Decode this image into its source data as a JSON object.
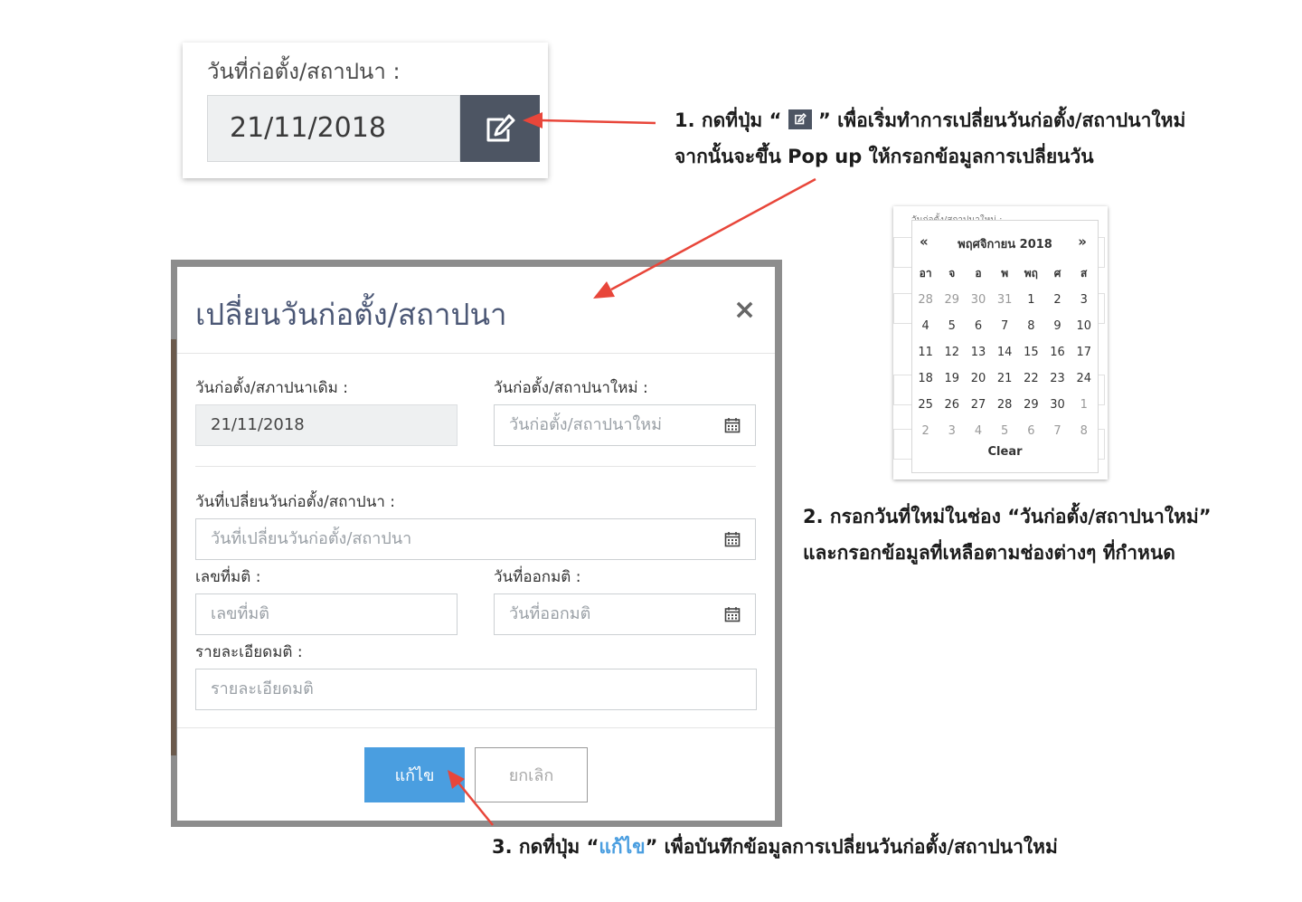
{
  "snippet": {
    "label": "วันที่ก่อตั้ง/สถาปนา :",
    "date_value": "21/11/2018"
  },
  "annotations": {
    "step1_line1_pre": "1. กดที่ปุ่ม “ ",
    "step1_line1_post": " ” เพื่อเริ่มทำการเปลี่ยนวันก่อตั้ง/สถาปนาใหม่",
    "step1_line2": "จากนั้นจะขึ้น Pop up ให้กรอกข้อมูลการเปลี่ยนวัน",
    "step2_line1": "2. กรอกวันที่ใหม่ในช่อง “วันก่อตั้ง/สถาปนาใหม่”",
    "step2_line2": "และกรอกข้อมูลที่เหลือตามช่องต่างๆ ที่กำหนด",
    "step3_pre": "3. กดที่ปุ่ม “",
    "step3_highlight": "แก้ไข",
    "step3_post": "” เพื่อบันทึกข้อมูลการเปลี่ยนวันก่อตั้ง/สถาปนาใหม่"
  },
  "modal": {
    "title": "เปลี่ยนวันก่อตั้ง/สถาปนา",
    "close": "×",
    "old_date_label": "วันก่อตั้ง/สภาปนาเดิม :",
    "old_date_value": "21/11/2018",
    "new_date_label": "วันก่อตั้ง/สถาปนาใหม่ :",
    "new_date_placeholder": "วันก่อตั้ง/สถาปนาใหม่",
    "change_date_label": "วันที่เปลี่ยนวันก่อตั้ง/สถาปนา :",
    "change_date_placeholder": "วันที่เปลี่ยนวันก่อตั้ง/สถาปนา",
    "resolution_no_label": "เลขที่มติ :",
    "resolution_no_placeholder": "เลขที่มติ",
    "resolution_date_label": "วันที่ออกมติ :",
    "resolution_date_placeholder": "วันที่ออกมติ",
    "resolution_detail_label": "รายละเอียดมติ :",
    "resolution_detail_placeholder": "รายละเอียดมติ",
    "save_button": "แก้ไข",
    "cancel_button": "ยกเลิก"
  },
  "calendar": {
    "ghost_label": "วันก่อตั้ง/สถาปนาใหม่ :",
    "prev": "«",
    "next": "»",
    "month_label": "พฤศจิกายน 2018",
    "weekdays": [
      "อา",
      "จ",
      "อ",
      "พ",
      "พฤ",
      "ศ",
      "ส"
    ],
    "weeks": [
      [
        "28",
        "29",
        "30",
        "31",
        "1",
        "2",
        "3"
      ],
      [
        "4",
        "5",
        "6",
        "7",
        "8",
        "9",
        "10"
      ],
      [
        "11",
        "12",
        "13",
        "14",
        "15",
        "16",
        "17"
      ],
      [
        "18",
        "19",
        "20",
        "21",
        "22",
        "23",
        "24"
      ],
      [
        "25",
        "26",
        "27",
        "28",
        "29",
        "30",
        "1"
      ],
      [
        "2",
        "3",
        "4",
        "5",
        "6",
        "7",
        "8"
      ]
    ],
    "clear": "Clear"
  },
  "colors": {
    "accent": "#4a9ee0",
    "edit_button_bg": "#4d5563",
    "arrow": "#e8463a",
    "modal_title": "#4b5775"
  }
}
